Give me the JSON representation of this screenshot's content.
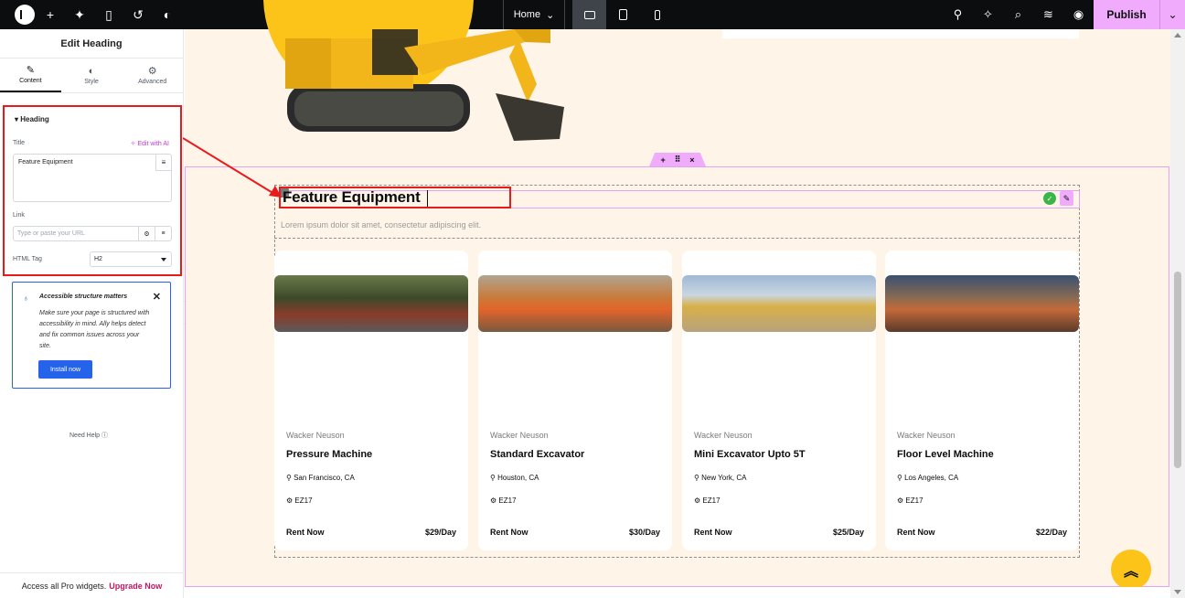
{
  "topbar": {
    "page_selector": "Home",
    "publish_label": "Publish"
  },
  "panel": {
    "title": "Edit Heading",
    "tabs": [
      {
        "label": "Content",
        "icon": "pencil-icon"
      },
      {
        "label": "Style",
        "icon": "contrast-icon"
      },
      {
        "label": "Advanced",
        "icon": "gear-icon"
      }
    ],
    "section_title": "Heading",
    "title_label": "Title",
    "edit_ai": "Edit with AI",
    "title_value": "Feature Equipment",
    "link_label": "Link",
    "link_placeholder": "Type or paste your URL",
    "html_tag_label": "HTML Tag",
    "html_tag_value": "H2",
    "notice": {
      "title": "Accessible structure matters",
      "body": "Make sure your page is structured with accessibility in mind. Ally helps detect and fix common issues across your site.",
      "button": "Install now"
    },
    "need_help": "Need Help",
    "pro_bar": {
      "text": "Access all Pro widgets.",
      "link": "Upgrade Now"
    }
  },
  "canvas": {
    "heading": "Feature Equipment",
    "subtitle": "Lorem ipsum dolor sit amet, consectetur adipiscing elit.",
    "cards": [
      {
        "brand": "Wacker Neuson",
        "name": "Pressure Machine",
        "location": "San Francisco, CA",
        "model": "EZ17",
        "rent": "Rent Now",
        "price": "$29/Day"
      },
      {
        "brand": "Wacker Neuson",
        "name": "Standard Excavator",
        "location": "Houston, CA",
        "model": "EZ17",
        "rent": "Rent Now",
        "price": "$30/Day"
      },
      {
        "brand": "Wacker Neuson",
        "name": "Mini Excavator Upto 5T",
        "location": "New York, CA",
        "model": "EZ17",
        "rent": "Rent Now",
        "price": "$25/Day"
      },
      {
        "brand": "Wacker Neuson",
        "name": "Floor Level Machine",
        "location": "Los Angeles, CA",
        "model": "EZ17",
        "rent": "Rent Now",
        "price": "$22/Day"
      }
    ]
  },
  "colors": {
    "accent_pink": "#f0abfc",
    "highlight_red": "#e81b1b",
    "canvas_bg": "#fff4e8",
    "brand_yellow": "#fcc419",
    "notice_blue": "#2563eb"
  }
}
